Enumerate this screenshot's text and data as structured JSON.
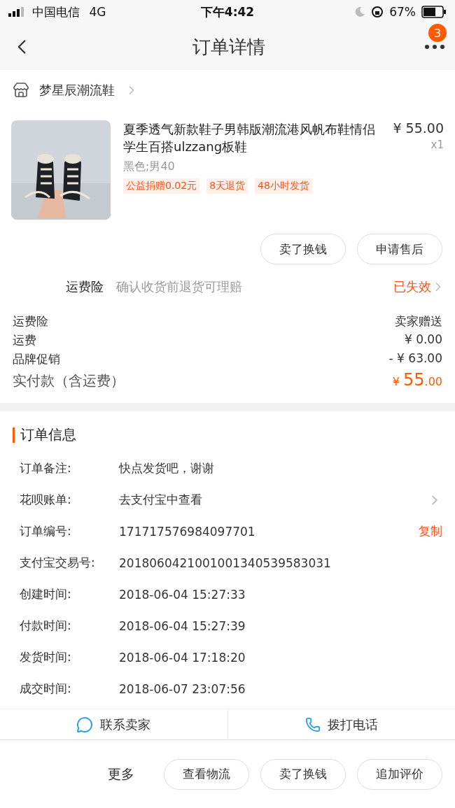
{
  "status_bar": {
    "carrier": "中国电信",
    "network": "4G",
    "time": "下午4:42",
    "battery": "67%"
  },
  "nav": {
    "title": "订单详情",
    "badge": "3"
  },
  "shop": {
    "name": "梦星辰潮流鞋"
  },
  "product": {
    "title": "夏季透气新款鞋子男韩版潮流港风帆布鞋情侣学生百搭ulzzang板鞋",
    "price": "¥ 55.00",
    "quantity": "x1",
    "spec": "黑色;男40",
    "tags": [
      "公益捐赠0.02元",
      "8天退货",
      "48小时发货"
    ]
  },
  "product_actions": [
    "卖了换钱",
    "申请售后"
  ],
  "insurance": {
    "label": "运费险",
    "description": "确认收货前退货可理赔",
    "status": "已失效"
  },
  "fees": [
    {
      "label": "运费险",
      "value": "卖家赠送"
    },
    {
      "label": "运费",
      "value": "¥ 0.00"
    },
    {
      "label": "品牌促销",
      "value": "- ¥ 63.00"
    }
  ],
  "total": {
    "label": "实付款（含运费）",
    "currency": "¥",
    "integer": "55",
    "decimal": ".00"
  },
  "order_info": {
    "title": "订单信息",
    "rows": [
      {
        "label": "订单备注:",
        "value": "快点发货吧，谢谢"
      },
      {
        "label": "花呗账单:",
        "value": "去支付宝中查看",
        "link": true
      },
      {
        "label": "订单编号:",
        "value": "171717576984097701",
        "action": "复制"
      },
      {
        "label": "支付宝交易号:",
        "value": "2018060421001001340539583031"
      },
      {
        "label": "创建时间:",
        "value": "2018-06-04 15:27:33"
      },
      {
        "label": "付款时间:",
        "value": "2018-06-04 15:27:39"
      },
      {
        "label": "发货时间:",
        "value": "2018-06-04 17:18:20"
      },
      {
        "label": "成交时间:",
        "value": "2018-06-07 23:07:56"
      }
    ]
  },
  "contacts": [
    {
      "kind": "chat",
      "label": "联系卖家"
    },
    {
      "kind": "phone",
      "label": "拨打电话"
    }
  ],
  "bottom_bar": {
    "more": "更多",
    "buttons": [
      "查看物流",
      "卖了换钱",
      "追加评价"
    ]
  }
}
